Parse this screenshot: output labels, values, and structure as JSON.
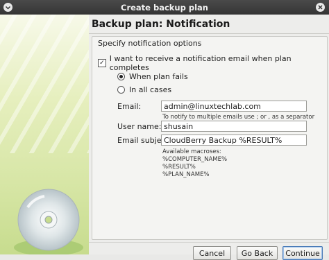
{
  "window": {
    "title": "Create backup plan"
  },
  "page": {
    "heading": "Backup plan: Notification"
  },
  "notification": {
    "section_label": "Specify notification options",
    "enable_label": "I want to receive a notification email when plan completes",
    "enable_checked": true,
    "options": [
      {
        "label": "When plan fails",
        "selected": true
      },
      {
        "label": "In all cases",
        "selected": false
      }
    ]
  },
  "form": {
    "email_label": "Email:",
    "email_value": "admin@linuxtechlab.com",
    "email_hint": "To notify to multiple emails use ; or , as a separator",
    "username_label": "User name:",
    "username_value": "shusain",
    "subject_label": "Email subject:",
    "subject_value": "CloudBerry Backup %RESULT%",
    "macros_title": "Available macroses:",
    "macros": [
      "%COMPUTER_NAME%",
      "%RESULT%",
      "%PLAN_NAME%"
    ]
  },
  "footer": {
    "cancel_label": "Cancel",
    "back_label": "Go Back",
    "continue_label": "Continue"
  },
  "colors": {
    "banner": "#d7e6a6",
    "titlebar": "#3c3c3c",
    "focus": "#4a7bb7"
  }
}
